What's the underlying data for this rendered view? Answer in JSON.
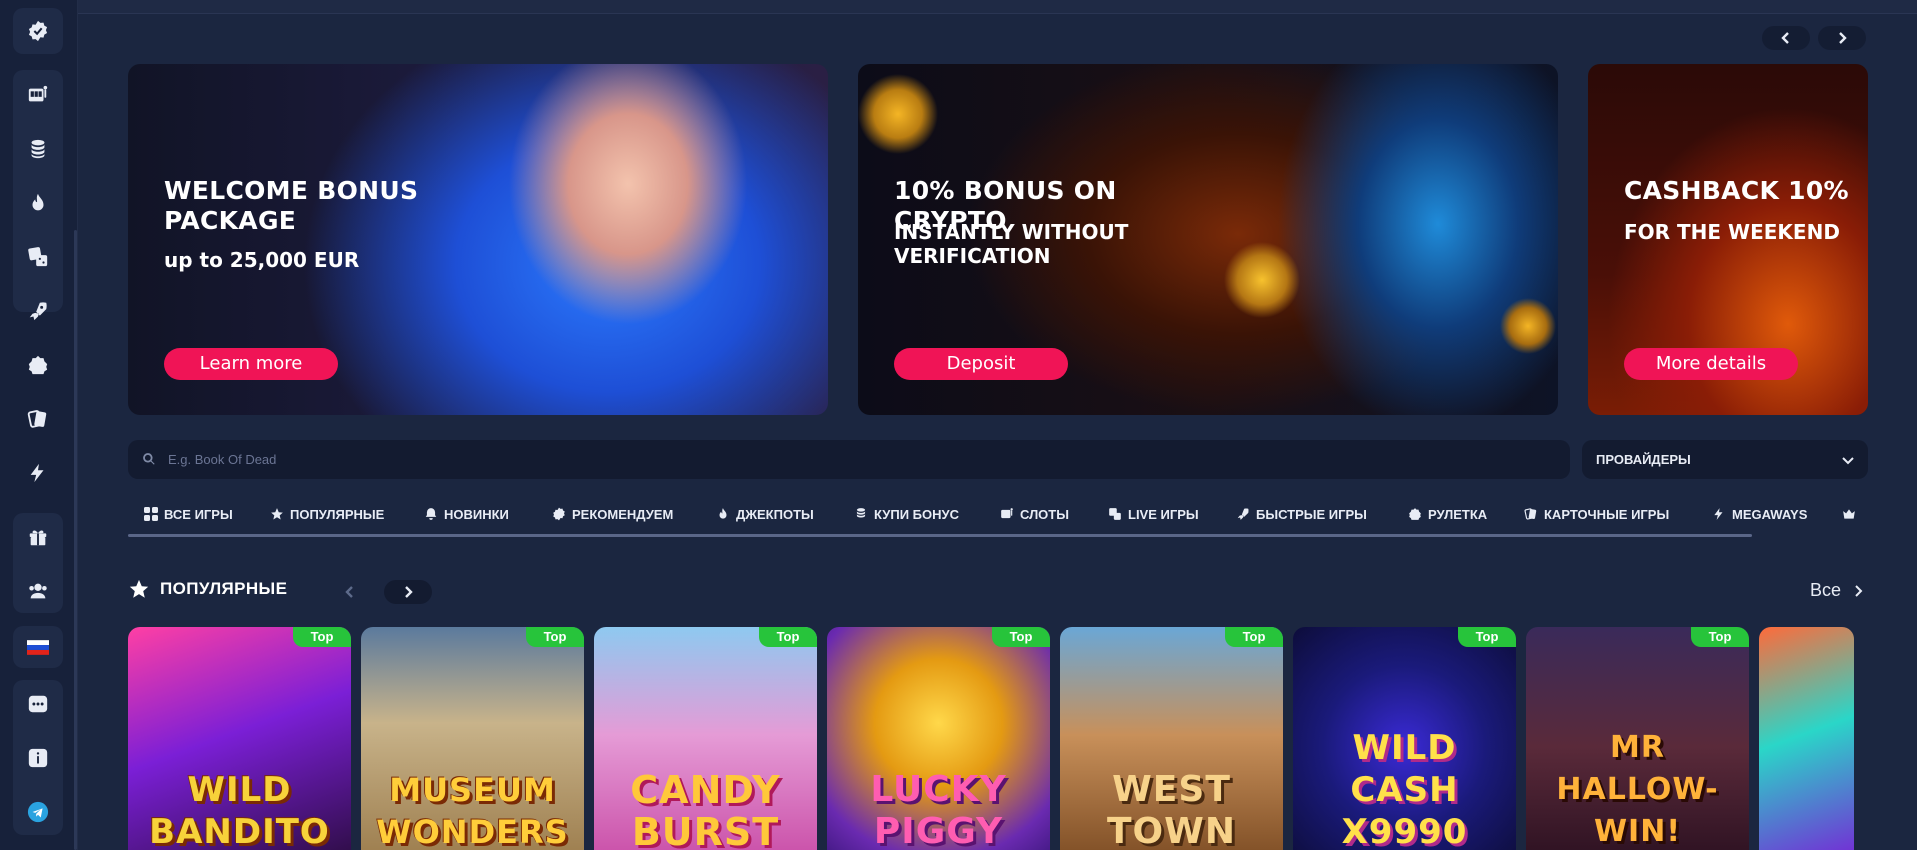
{
  "sidebar": {
    "items": [
      {
        "name": "sidebar-item-recommended",
        "icon": "badge-check-icon"
      },
      {
        "name": "sidebar-item-slots",
        "icon": "slot-machine-icon"
      },
      {
        "name": "sidebar-item-buy-bonus",
        "icon": "coins-icon"
      },
      {
        "name": "sidebar-item-jackpots",
        "icon": "flame-icon"
      },
      {
        "name": "sidebar-item-live",
        "icon": "dice-icon"
      },
      {
        "name": "sidebar-item-fast-games",
        "icon": "rocket-icon"
      },
      {
        "name": "sidebar-item-roulette",
        "icon": "roulette-icon"
      },
      {
        "name": "sidebar-item-card-games",
        "icon": "cards-icon"
      },
      {
        "name": "sidebar-item-megaways",
        "icon": "lightning-icon"
      },
      {
        "name": "sidebar-item-promotions",
        "icon": "gift-icon"
      },
      {
        "name": "sidebar-item-affiliates",
        "icon": "users-icon"
      },
      {
        "name": "sidebar-item-language",
        "icon": "russia-flag-icon"
      },
      {
        "name": "sidebar-item-chat",
        "icon": "chat-icon"
      },
      {
        "name": "sidebar-item-info",
        "icon": "info-icon"
      },
      {
        "name": "sidebar-item-telegram",
        "icon": "telegram-icon"
      }
    ]
  },
  "banners": [
    {
      "title": "WELCOME BONUS PACKAGE",
      "subtitle": "up to 25,000 EUR",
      "cta": "Learn more"
    },
    {
      "title": "10% BONUS ON CRYPTO",
      "subtitle": "INSTANTLY WITHOUT VERIFICATION",
      "cta": "Deposit"
    },
    {
      "title": "CASHBACK 10%",
      "subtitle": "FOR THE WEEKEND",
      "cta": "More details"
    }
  ],
  "search": {
    "placeholder": "E.g. Book Of Dead"
  },
  "providers": {
    "label": "ПРОВАЙДЕРЫ"
  },
  "categories": [
    {
      "label": "ВСЕ ИГРЫ",
      "icon": "grid-icon"
    },
    {
      "label": "ПОПУЛЯРНЫЕ",
      "icon": "star-icon"
    },
    {
      "label": "НОВИНКИ",
      "icon": "bell-icon"
    },
    {
      "label": "РЕКОМЕНДУЕМ",
      "icon": "badge-check-icon"
    },
    {
      "label": "ДЖЕКПОТЫ",
      "icon": "flame-icon"
    },
    {
      "label": "КУПИ БОНУС",
      "icon": "coins-icon"
    },
    {
      "label": "СЛОТЫ",
      "icon": "slot-machine-icon"
    },
    {
      "label": "LIVE ИГРЫ",
      "icon": "dice-icon"
    },
    {
      "label": "БЫСТРЫЕ ИГРЫ",
      "icon": "rocket-icon"
    },
    {
      "label": "РУЛЕТКА",
      "icon": "roulette-icon"
    },
    {
      "label": "КАРТОЧНЫЕ ИГРЫ",
      "icon": "cards-icon"
    },
    {
      "label": "MEGAWAYS",
      "icon": "lightning-icon"
    }
  ],
  "popular": {
    "title": "ПОПУЛЯРНЫЕ",
    "all_label": "Все",
    "games": [
      {
        "name": "WILD BANDITO",
        "badge": "Top"
      },
      {
        "name": "MUSEUM WONDERS",
        "badge": "Top"
      },
      {
        "name": "CANDY BURST",
        "badge": "Top"
      },
      {
        "name": "LUCKY PIGGY",
        "badge": "Top"
      },
      {
        "name": "WEST TOWN",
        "badge": "Top"
      },
      {
        "name": "WILD CASH X9990",
        "badge": "Top"
      },
      {
        "name": "MR HALLOW-WIN!",
        "badge": "Top"
      }
    ]
  }
}
